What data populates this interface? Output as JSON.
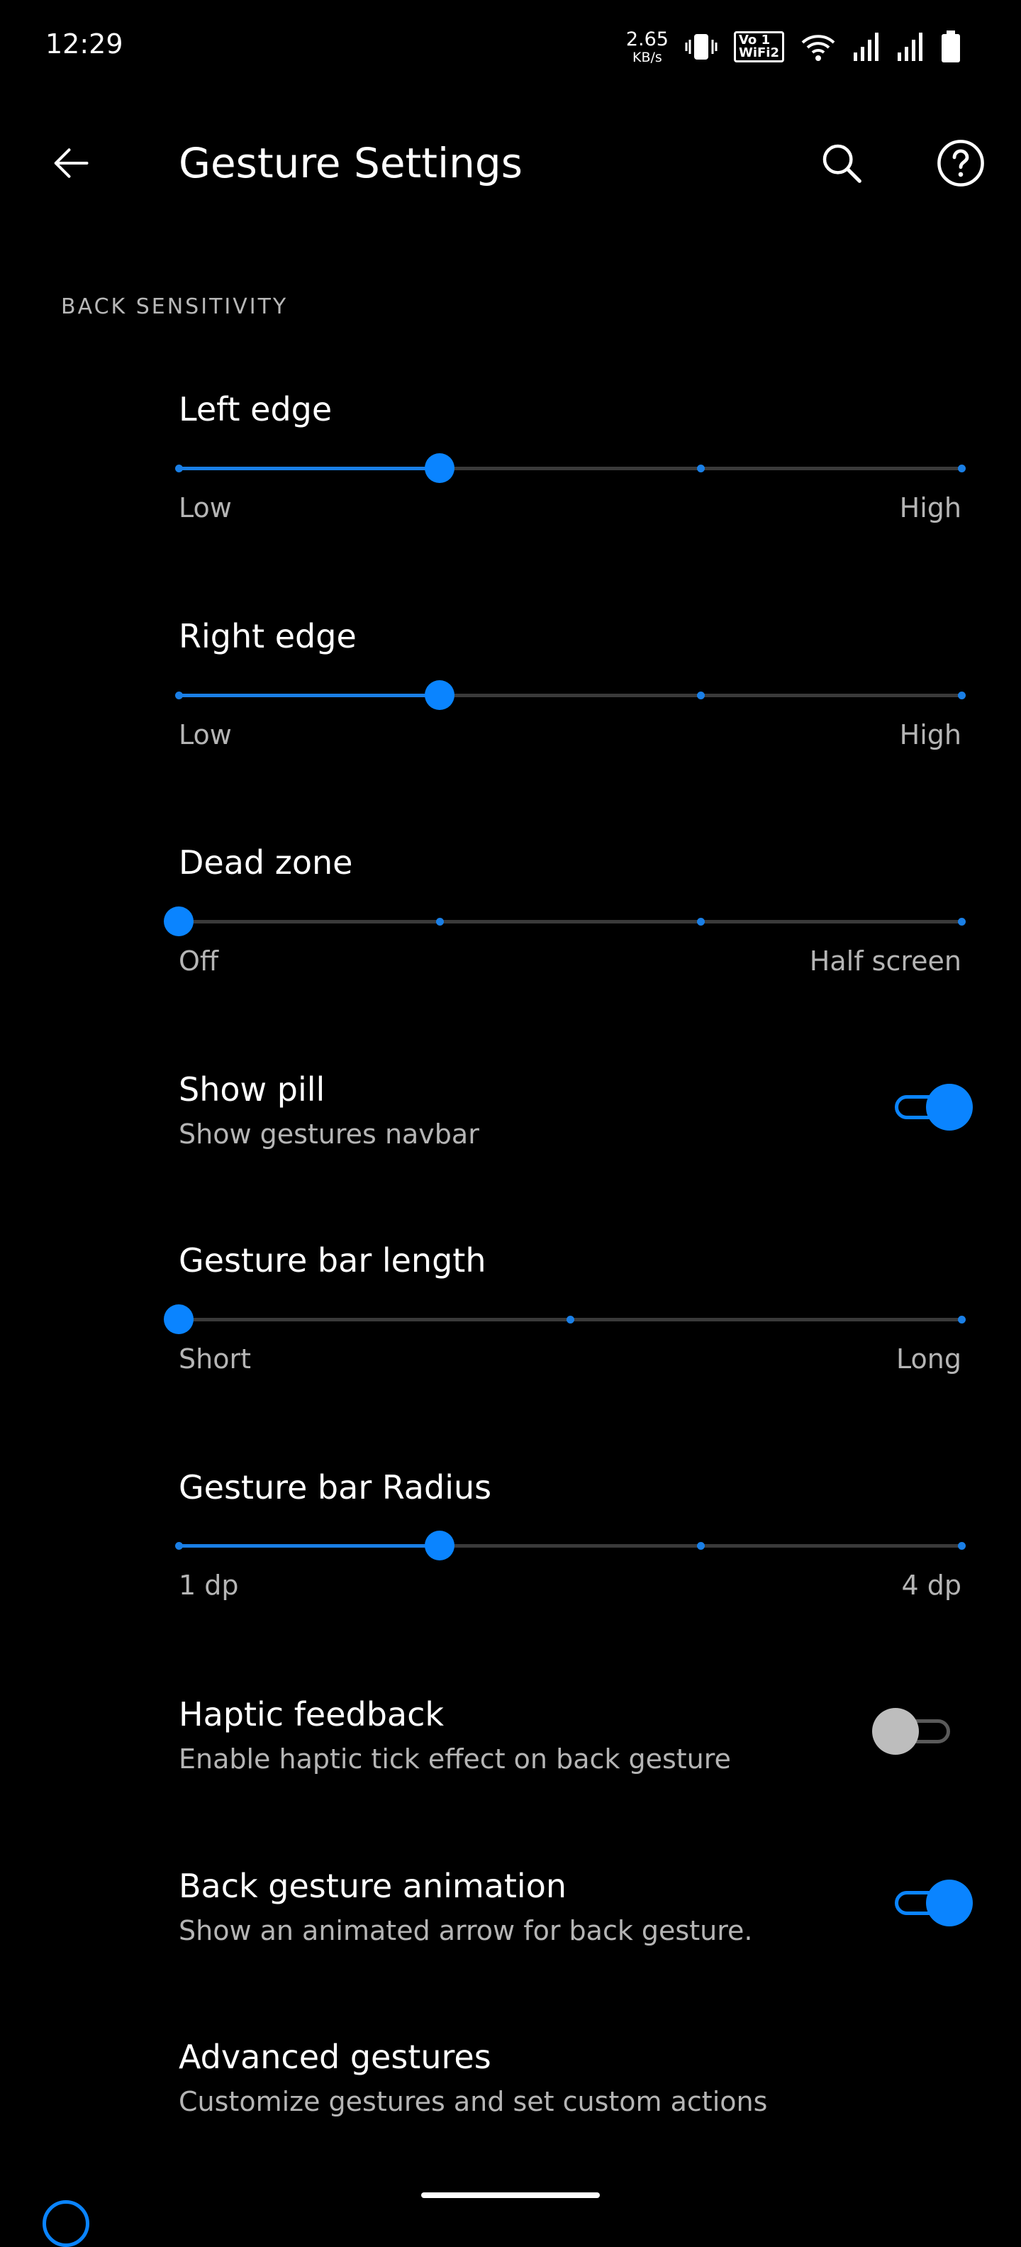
{
  "status_bar": {
    "time": "12:29",
    "net_speed_value": "2.65",
    "net_speed_unit": "KB/s",
    "volte_top": "Vo",
    "volte_top_right": "1",
    "volte_bottom": "WiFi2",
    "icons": [
      "vibrate-icon",
      "volte-wifi-icon",
      "wifi-icon",
      "signal-sim1-icon",
      "signal-sim2-icon",
      "battery-icon"
    ]
  },
  "app_bar": {
    "title": "Gesture Settings",
    "back_icon": "arrow-left-icon",
    "search_icon": "search-icon",
    "help_icon": "help-circle-icon"
  },
  "section": {
    "header": "BACK SENSITIVITY"
  },
  "prefs": {
    "left_edge": {
      "title": "Left edge",
      "min_label": "Low",
      "max_label": "High",
      "steps": 3,
      "value": 1
    },
    "right_edge": {
      "title": "Right edge",
      "min_label": "Low",
      "max_label": "High",
      "steps": 3,
      "value": 1
    },
    "dead_zone": {
      "title": "Dead zone",
      "min_label": "Off",
      "max_label": "Half screen",
      "steps": 3,
      "value": 0
    },
    "show_pill": {
      "title": "Show pill",
      "summary": "Show gestures navbar",
      "enabled": true
    },
    "gesture_bar_length": {
      "title": "Gesture bar length",
      "min_label": "Short",
      "max_label": "Long",
      "steps": 2,
      "value": 0
    },
    "gesture_bar_radius": {
      "title": "Gesture bar Radius",
      "min_label": "1 dp",
      "max_label": "4 dp",
      "steps": 3,
      "value": 1
    },
    "haptic_feedback": {
      "title": "Haptic feedback",
      "summary": "Enable haptic tick effect on back gesture",
      "enabled": false
    },
    "back_gesture_animation": {
      "title": "Back gesture animation",
      "summary": "Show an animated arrow for back gesture.",
      "enabled": true
    },
    "advanced_gestures": {
      "title": "Advanced gestures",
      "summary": "Customize gestures and set custom actions"
    }
  },
  "colors": {
    "accent": "#0a84ff",
    "track": "#3a3a3a",
    "background": "#000000",
    "secondary_text": "#b5b5b5"
  }
}
